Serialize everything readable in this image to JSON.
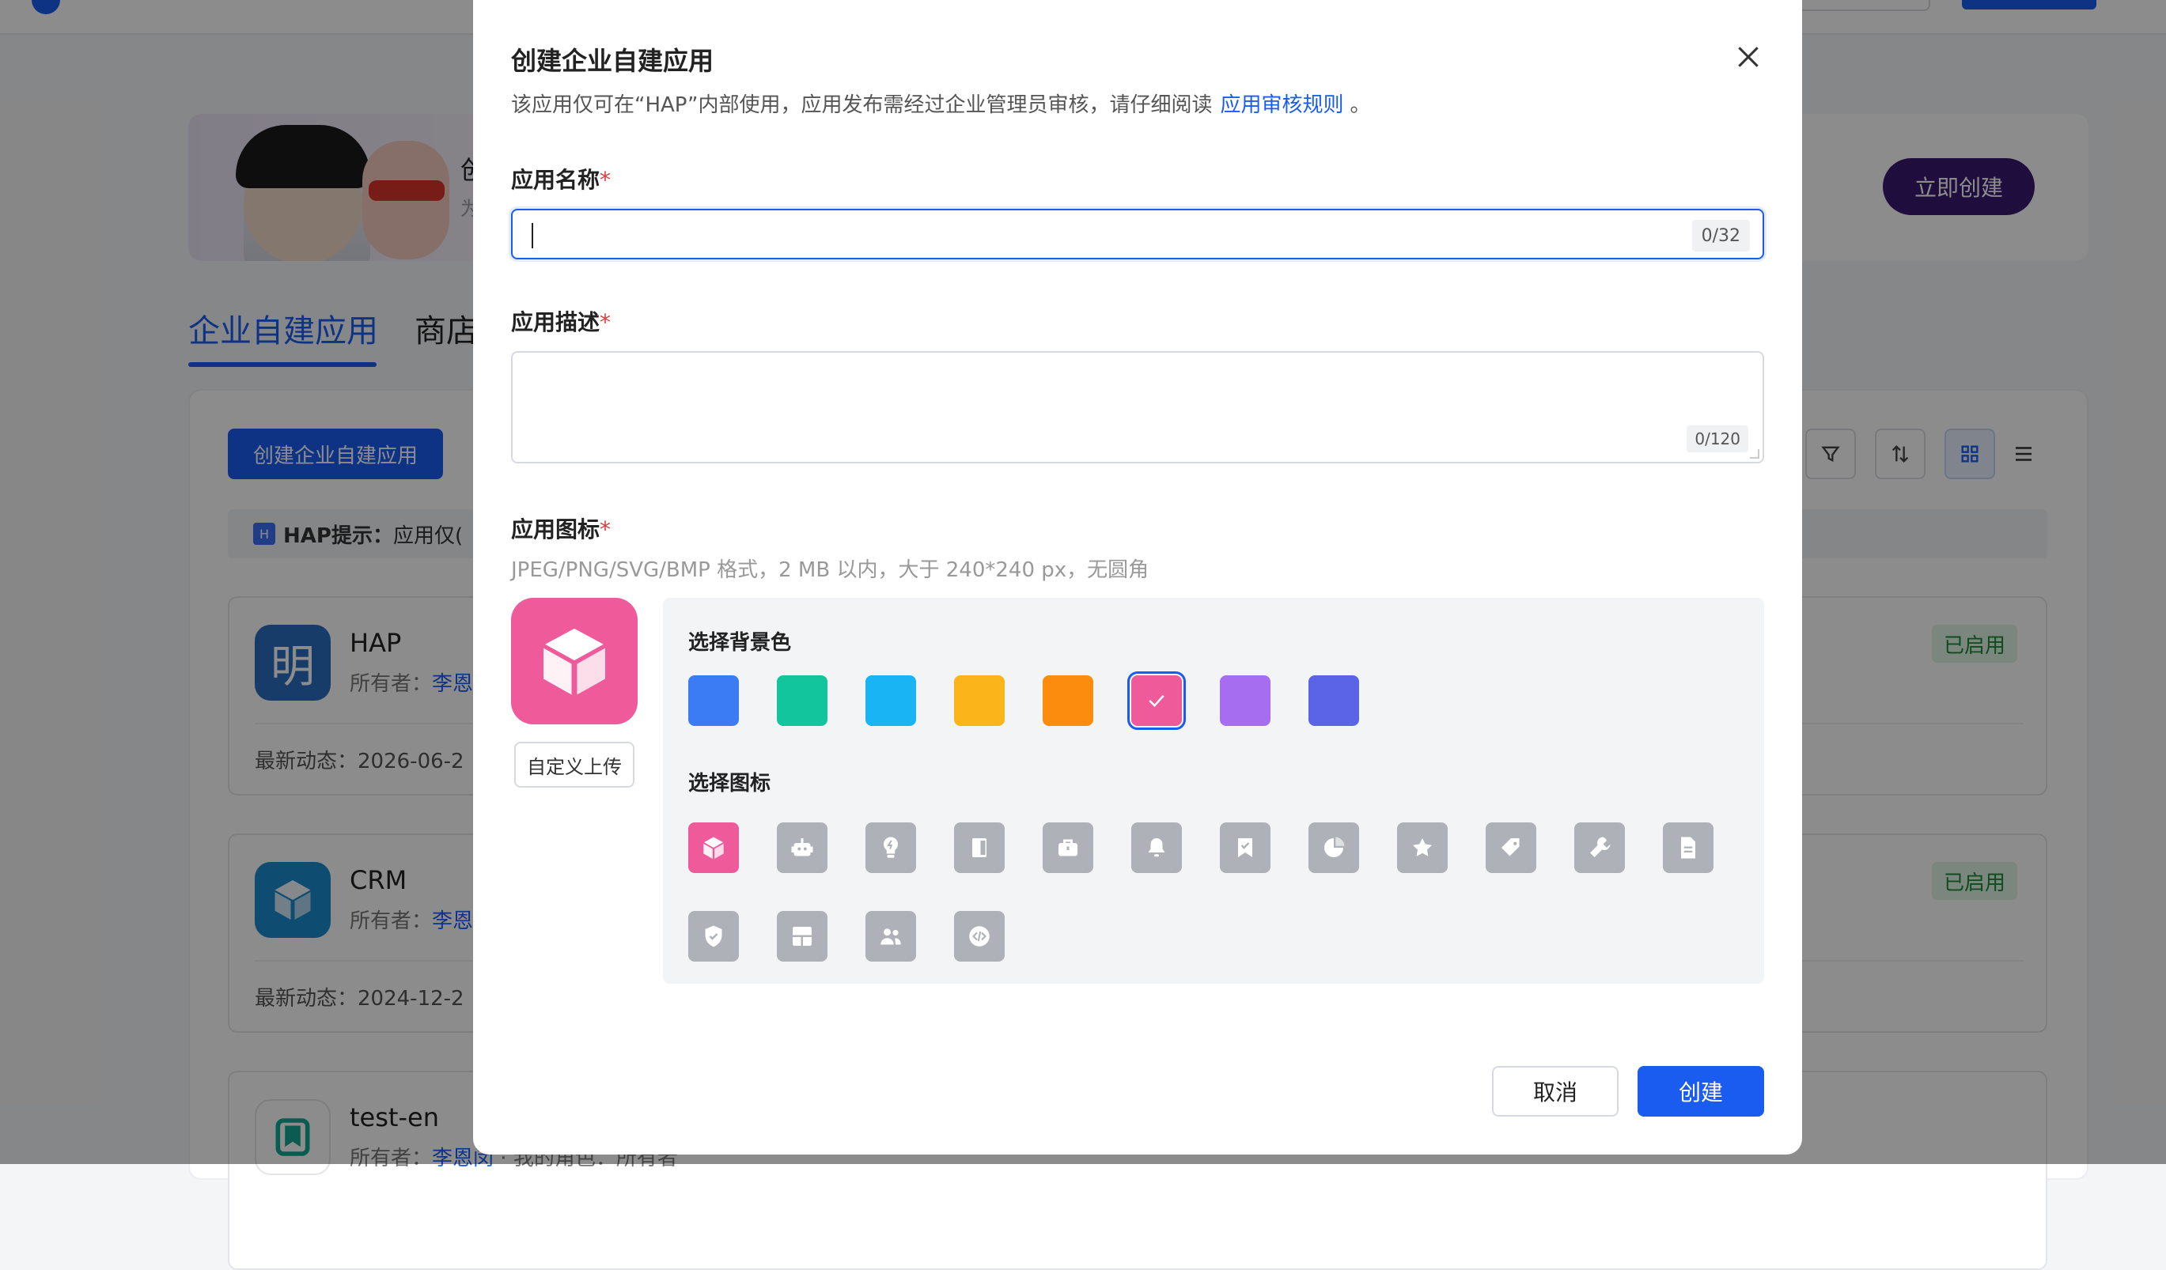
{
  "background": {
    "banner": {
      "title_fragment": "创",
      "subtitle_fragment": "为",
      "create_now_label": "立即创建"
    },
    "tabs": [
      {
        "label": "企业自建应用",
        "active": true
      },
      {
        "label": "商店",
        "active": false
      }
    ],
    "create_app_button": "创建企业自建应用",
    "hint": {
      "badge": "H",
      "label": "HAP提示：",
      "text": "应用仅("
    },
    "apps": [
      {
        "name": "HAP",
        "owner_label": "所有者：",
        "owner": "李恩",
        "latest_label": "最新动态：",
        "latest": "2026-06-2",
        "status": "已启用",
        "icon_text": "明",
        "icon_color": "#2d6ebf"
      },
      {
        "name": "CRM",
        "owner_label": "所有者：",
        "owner": "李恩",
        "latest_label": "最新动态：",
        "latest": "2024-12-2",
        "status": "已启用",
        "icon_text": "",
        "icon_color": "#1a8bd0"
      },
      {
        "name": "test-en",
        "owner_label": "所有者：",
        "owner": "李恩闵",
        "role_label": "我的角色：",
        "role": "所有者",
        "icon_text": "",
        "icon_color": "#14a892"
      }
    ]
  },
  "modal": {
    "title": "创建企业自建应用",
    "description": "该应用仅可在“HAP”内部使用，应用发布需经过企业管理员审核，请仔细阅读",
    "description_link": "应用审核规则",
    "description_end": "。",
    "name_field": {
      "label": "应用名称",
      "required_mark": "*",
      "value": "",
      "counter": "0/32"
    },
    "desc_field": {
      "label": "应用描述",
      "required_mark": "*",
      "value": "",
      "counter": "0/120"
    },
    "icon_field": {
      "label": "应用图标",
      "required_mark": "*",
      "hint": "JPEG/PNG/SVG/BMP 格式，2 MB 以内，大于 240*240 px，无圆角",
      "upload_label": "自定义上传",
      "preview_color": "#ee5a9a",
      "bg_label": "选择背景色",
      "bg_colors": [
        "#3b7cf4",
        "#13c59d",
        "#18b4f4",
        "#fbb51a",
        "#fb8c0e",
        "#ee5a9a",
        "#a76df1",
        "#5b63e6"
      ],
      "selected_bg_index": 5,
      "icon_label": "选择图标",
      "icons": [
        "cube-icon",
        "robot-icon",
        "lightbulb-icon",
        "door-icon",
        "briefcase-icon",
        "bell-icon",
        "bookmark-check-icon",
        "pie-chart-icon",
        "star-icon",
        "tag-icon",
        "wrench-icon",
        "document-icon",
        "shield-check-icon",
        "layout-icon",
        "users-icon",
        "code-icon"
      ],
      "selected_icon_index": 0
    },
    "cancel_label": "取消",
    "create_label": "创建"
  }
}
